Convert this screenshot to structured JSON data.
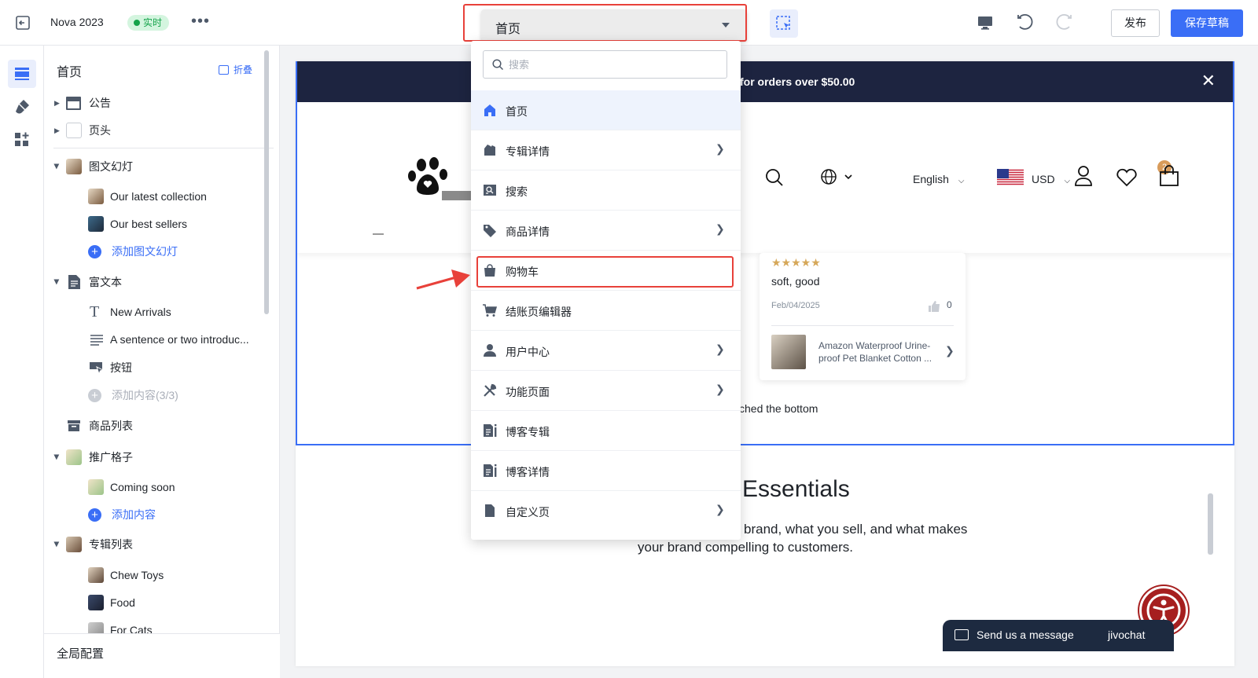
{
  "topbar": {
    "store_name": "Nova 2023",
    "live_badge": "实时",
    "page_select_value": "首页",
    "publish_label": "发布",
    "save_label": "保存草稿"
  },
  "sidebar": {
    "title": "首页",
    "collapse_label": "折叠",
    "rows": {
      "announcement": "公告",
      "header": "页头",
      "slideshow": "图文幻灯",
      "slide1": "Our latest collection",
      "slide2": "Our best sellers",
      "add_slide": "添加图文幻灯",
      "richtext": "富文本",
      "rt_heading": "New Arrivals",
      "rt_text": "A sentence or two introduc...",
      "rt_button": "按钮",
      "rt_add": "添加内容(3/3)",
      "product_list": "商品列表",
      "promo_grid": "推广格子",
      "promo1": "Coming soon",
      "promo_add": "添加内容",
      "collection_list": "专辑列表",
      "col1": "Chew Toys",
      "col2": "Food",
      "col3": "For Cats"
    },
    "footer": "全局配置"
  },
  "dropdown": {
    "search_placeholder": "搜索",
    "items": [
      {
        "label": "首页",
        "icon": "home-icon"
      },
      {
        "label": "专辑详情",
        "icon": "collection-icon"
      },
      {
        "label": "搜索",
        "icon": "search-page-icon"
      },
      {
        "label": "商品详情",
        "icon": "tag-icon"
      },
      {
        "label": "购物车",
        "icon": "bag-icon"
      },
      {
        "label": "结账页编辑器",
        "icon": "cart-icon"
      },
      {
        "label": "用户中心",
        "icon": "user-icon"
      },
      {
        "label": "功能页面",
        "icon": "tools-icon"
      },
      {
        "label": "博客专辑",
        "icon": "blog-icon"
      },
      {
        "label": "博客详情",
        "icon": "blog-detail-icon"
      },
      {
        "label": "自定义页",
        "icon": "page-icon"
      }
    ]
  },
  "preview": {
    "announcement": "for orders over $50.00",
    "language": "English",
    "currency": "USD",
    "wishlist_count": "2",
    "review": {
      "stars": "★★★★★",
      "text": "soft, good",
      "date": "Feb/04/2025",
      "likes": "0",
      "product": "Amazon Waterproof Urine-proof Pet Blanket Cotton ..."
    },
    "reached_bottom": "ched the bottom",
    "essentials_title": "Essentials",
    "essentials_body_1": "brand, what you sell, and what makes",
    "essentials_body_2": "your brand compelling to customers."
  },
  "chat": {
    "message": "Send us a message",
    "brand": "jivochat"
  },
  "colors": {
    "accent": "#3a6ef6",
    "highlight": "#e8413a",
    "announcement_bg": "#1d2440"
  }
}
